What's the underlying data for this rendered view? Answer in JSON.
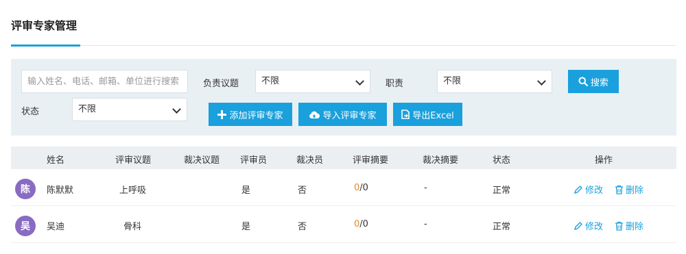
{
  "page": {
    "title": "评审专家管理"
  },
  "filters": {
    "search_placeholder": "输入姓名、电话、邮箱、单位进行搜索",
    "topic_label": "负责议题",
    "topic_value": "不限",
    "duty_label": "职责",
    "duty_value": "不限",
    "status_label": "状态",
    "status_value": "不限",
    "search_button": "搜索",
    "add_button": "添加评审专家",
    "import_button": "导入评审专家",
    "export_button": "导出Excel"
  },
  "table": {
    "columns": [
      "姓名",
      "评审议题",
      "裁决议题",
      "评审员",
      "裁决员",
      "评审摘要",
      "裁决摘要",
      "状态",
      "操作"
    ],
    "rows": [
      {
        "avatar": "陈",
        "name": "陈默默",
        "review_topic": "上呼吸",
        "ruling_topic": "",
        "reviewer": "是",
        "arbiter": "否",
        "review_done": "0",
        "review_total": "/0",
        "ruling_summary": "-",
        "status": "正常",
        "edit": "修改",
        "delete": "删除"
      },
      {
        "avatar": "吴",
        "name": "吴迪",
        "review_topic": "骨科",
        "ruling_topic": "",
        "reviewer": "是",
        "arbiter": "否",
        "review_done": "0",
        "review_total": "/0",
        "ruling_summary": "-",
        "status": "正常",
        "edit": "修改",
        "delete": "删除"
      }
    ]
  },
  "colors": {
    "accent": "#1aa0dd",
    "avatar": "#8a6bc2",
    "panel": "#e9f0f4",
    "highlight": "#e58a26"
  }
}
